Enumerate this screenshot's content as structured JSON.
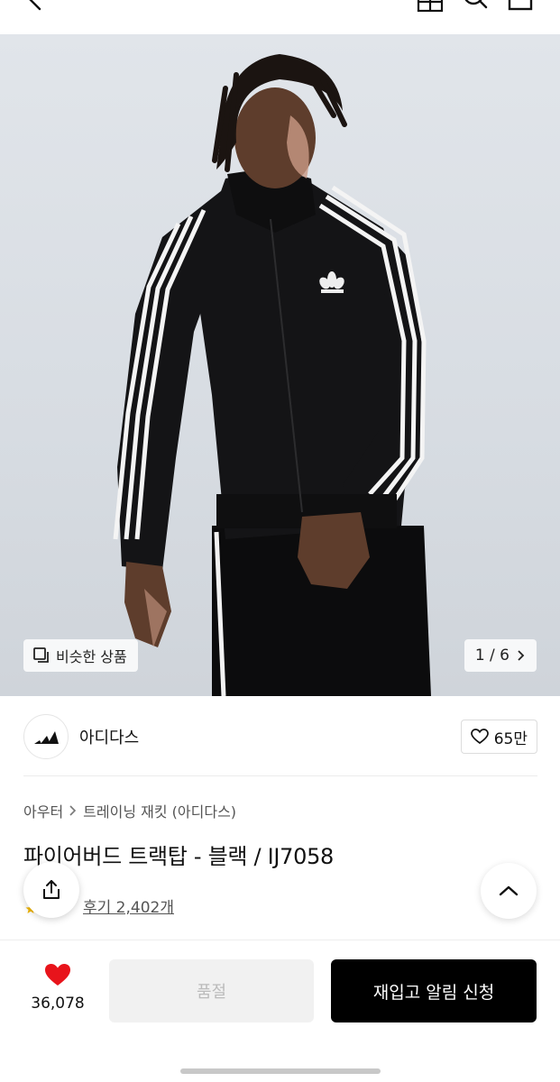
{
  "header": {
    "back_icon": "chevron-left-icon",
    "icons": [
      "store-icon",
      "search-icon",
      "bag-icon"
    ]
  },
  "gallery": {
    "similar_label": "비슷한 상품",
    "pager": "1 / 6"
  },
  "brand": {
    "name": "아디다스",
    "likes": "65만"
  },
  "breadcrumb": {
    "category": "아우터",
    "subcategory": "트레이닝 재킷 (아디다스)"
  },
  "product": {
    "title": "파이어버드 트랙탑 - 블랙 / IJ7058",
    "review_link": "후기 2,402개"
  },
  "bottom": {
    "wish_count": "36,078",
    "soldout_label": "품절",
    "restock_label": "재입고 알림 신청"
  },
  "colors": {
    "heart": "#e8141b",
    "cta": "#000000",
    "disabled": "#f1f1f1"
  }
}
